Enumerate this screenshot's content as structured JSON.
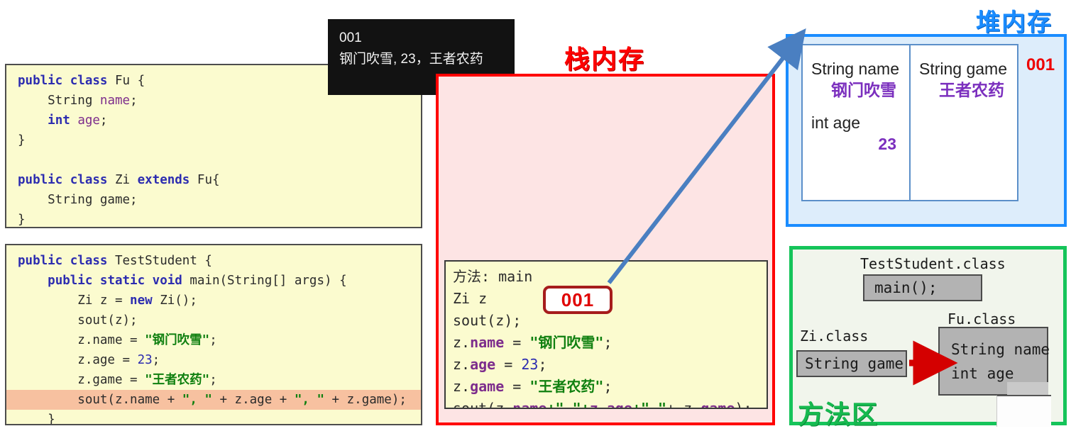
{
  "console": {
    "name": "console-output",
    "lines": [
      "001",
      "钢门吹雪, 23，王者农药"
    ]
  },
  "code_panel_top": {
    "lines": [
      "public class Fu {",
      "    String name;",
      "    int age;",
      "}",
      "",
      "public class Zi extends Fu{",
      "    String game;",
      "}"
    ]
  },
  "code_panel_bottom": {
    "lines": [
      "public class TestStudent {",
      "    public static void main(String[] args) {",
      "        Zi z = new Zi();",
      "        sout(z);",
      "        z.name = \"钢门吹雪\";",
      "        z.age = 23;",
      "        z.game = \"王者农药\";",
      "        sout(z.name + \", \" + z.age + \", \" + z.game);",
      "    }"
    ],
    "highlighted_line_index": 7
  },
  "stack": {
    "title": "栈内存",
    "title_color": "#ff0000",
    "frame": {
      "lines": [
        "方法: main",
        "Zi z",
        "sout(z);",
        "z.name = \"钢门吹雪\";",
        "z.age = 23;",
        "z.game = \"王者农药\";",
        "sout(z.name+\",\"+z.age+\",\"+ z.game);"
      ]
    },
    "reference_value": "001"
  },
  "heap": {
    "title": "堆内存",
    "title_color": "#1a8cff",
    "object_id": "001",
    "fields_left": [
      {
        "type_name": "String name",
        "value": "钢门吹雪"
      },
      {
        "type_name": "int age",
        "value": "23"
      }
    ],
    "fields_right": [
      {
        "type_name": "String game",
        "value": "王者农药"
      }
    ]
  },
  "method_area": {
    "title": "方法区",
    "title_color": "#16b94f",
    "test_student_class_label": "TestStudent.class",
    "test_student_members": [
      "main();"
    ],
    "zi_class_label": "Zi.class",
    "zi_members": [
      "String game"
    ],
    "fu_class_label": "Fu.class",
    "fu_members": [
      "String name",
      "int age"
    ]
  }
}
